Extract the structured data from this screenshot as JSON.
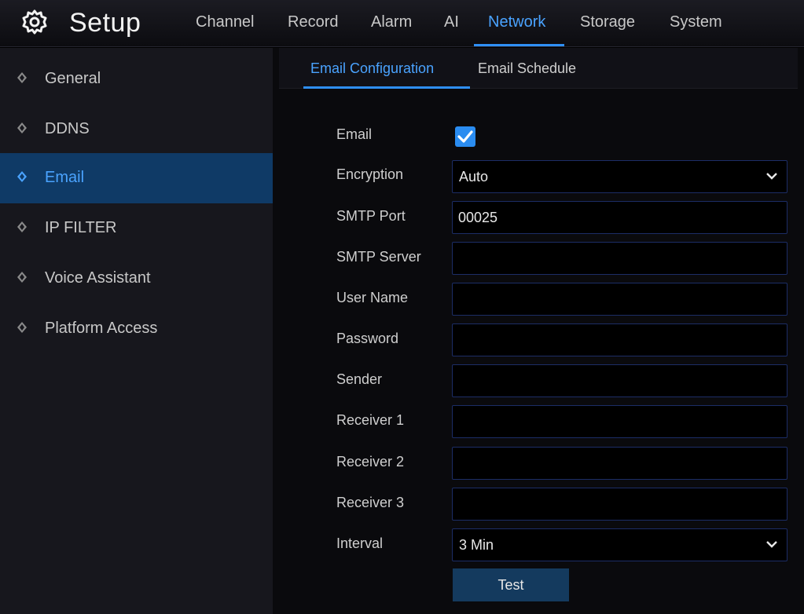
{
  "header": {
    "title": "Setup",
    "menu": [
      {
        "label": "Channel",
        "active": false
      },
      {
        "label": "Record",
        "active": false
      },
      {
        "label": "Alarm",
        "active": false
      },
      {
        "label": "AI",
        "active": false
      },
      {
        "label": "Network",
        "active": true
      },
      {
        "label": "Storage",
        "active": false
      },
      {
        "label": "System",
        "active": false
      }
    ]
  },
  "sidebar": {
    "items": [
      {
        "label": "General",
        "active": false
      },
      {
        "label": "DDNS",
        "active": false
      },
      {
        "label": "Email",
        "active": true
      },
      {
        "label": "IP FILTER",
        "active": false
      },
      {
        "label": "Voice Assistant",
        "active": false
      },
      {
        "label": "Platform Access",
        "active": false
      }
    ]
  },
  "tabs": [
    {
      "label": "Email Configuration",
      "active": true
    },
    {
      "label": "Email Schedule",
      "active": false
    }
  ],
  "form": {
    "email_label": "Email",
    "email_enabled": true,
    "encryption_label": "Encryption",
    "encryption_value": "Auto",
    "smtp_port_label": "SMTP Port",
    "smtp_port_value": "00025",
    "smtp_server_label": "SMTP Server",
    "smtp_server_value": "",
    "user_name_label": "User Name",
    "user_name_value": "",
    "password_label": "Password",
    "password_value": "",
    "sender_label": "Sender",
    "sender_value": "",
    "receiver1_label": "Receiver 1",
    "receiver1_value": "",
    "receiver2_label": "Receiver 2",
    "receiver2_value": "",
    "receiver3_label": "Receiver 3",
    "receiver3_value": "",
    "interval_label": "Interval",
    "interval_value": "3 Min",
    "test_label": "Test"
  },
  "colors": {
    "accent": "#2f8ff5",
    "accent_text": "#4aa3ff",
    "active_sidebar_bg": "#0f3a66",
    "field_border": "#1c2d66"
  },
  "icons": {
    "logo": "gear-icon",
    "sidebar": "diamond-icon",
    "checkbox": "check-icon",
    "dropdown": "chevron-down-icon"
  }
}
